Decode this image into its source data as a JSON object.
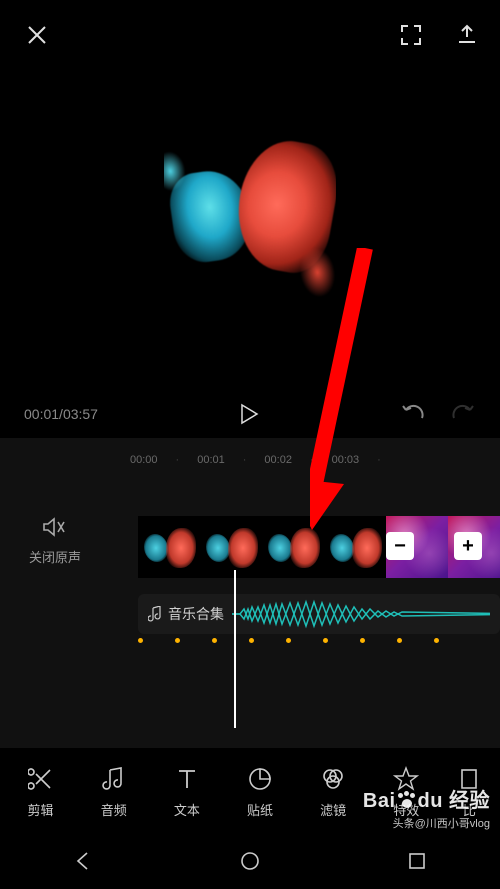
{
  "time": {
    "current": "00:01",
    "total": "03:57"
  },
  "ruler": [
    "00:00",
    "00:01",
    "00:02",
    "00:03"
  ],
  "mute_label": "关闭原声",
  "audio_track_label": "音乐合集",
  "buttons": {
    "minus": "−",
    "plus": "+"
  },
  "tools": [
    {
      "key": "cut",
      "label": "剪辑"
    },
    {
      "key": "audio",
      "label": "音频"
    },
    {
      "key": "text",
      "label": "文本"
    },
    {
      "key": "sticker",
      "label": "贴纸"
    },
    {
      "key": "filter",
      "label": "滤镜"
    },
    {
      "key": "effect",
      "label": "特效"
    },
    {
      "key": "ratio",
      "label": "比"
    }
  ],
  "watermark": {
    "brand_left": "Bai",
    "brand_right": "经验",
    "author": "头条@川西小哥vlog"
  }
}
